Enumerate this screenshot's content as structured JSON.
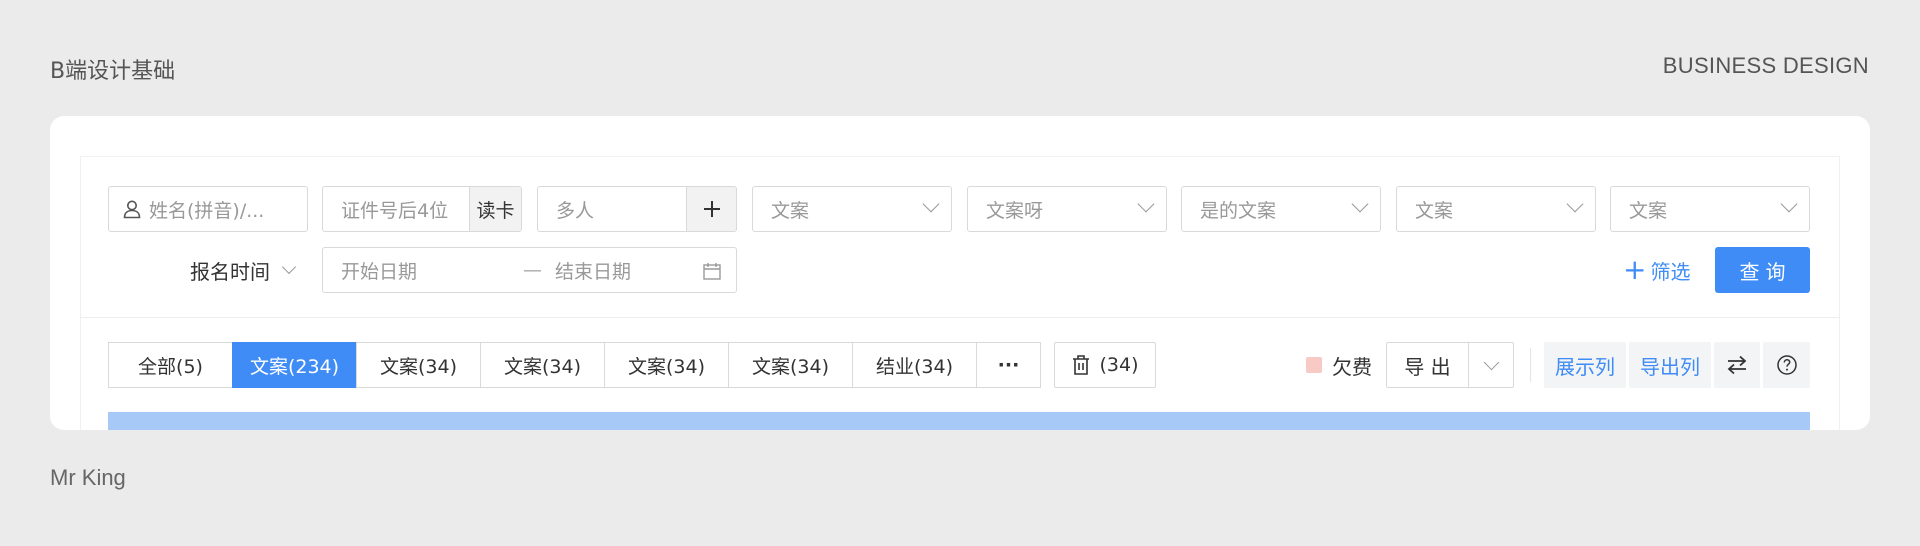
{
  "header": {
    "title": "B端设计基础",
    "brand": "BUSINESS DESIGN"
  },
  "footer": {
    "author": "Mr King"
  },
  "filters": {
    "name_placeholder": "姓名(拼音)/...",
    "id_placeholder": "证件号后4位",
    "read_card": "读卡",
    "multi_placeholder": "多人",
    "add_symbol": "+",
    "selects": [
      "文案",
      "文案呀",
      "是的文案",
      "文案",
      "文案"
    ],
    "date_label": "报名时间",
    "start_date": "开始日期",
    "date_sep": "—",
    "end_date": "结束日期",
    "filter_label": "筛选",
    "filter_plus": "+",
    "query_label": "查询"
  },
  "tabs": [
    {
      "label": "全部(5)",
      "active": false
    },
    {
      "label": "文案(234)",
      "active": true
    },
    {
      "label": "文案(34)",
      "active": false
    },
    {
      "label": "文案(34)",
      "active": false
    },
    {
      "label": "文案(34)",
      "active": false
    },
    {
      "label": "文案(34)",
      "active": false
    },
    {
      "label": "结业(34)",
      "active": false
    },
    {
      "label": "···",
      "active": false
    }
  ],
  "trash_count": "(34)",
  "owe_label": "欠费",
  "export_label": "导 出",
  "show_cols": "展示列",
  "export_cols": "导出列",
  "colors": {
    "accent": "#3f8cf6",
    "owe_badge": "#f9c9c6",
    "bar": "#a6c9f7"
  }
}
